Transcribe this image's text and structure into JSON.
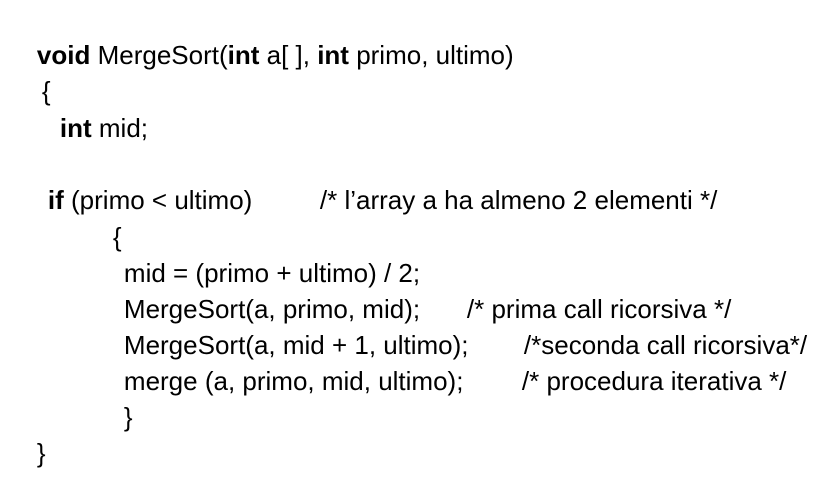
{
  "code": {
    "lines": [
      {
        "id": "signature",
        "parts": [
          {
            "text": "void",
            "bold": true
          },
          {
            "text": " MergeSort(",
            "bold": false
          },
          {
            "text": "int",
            "bold": true
          },
          {
            "text": " a[ ], ",
            "bold": false
          },
          {
            "text": "int",
            "bold": true
          },
          {
            "text": " primo, ultimo)",
            "bold": false
          }
        ]
      },
      {
        "id": "open-brace-func",
        "parts": [
          {
            "text": "{",
            "bold": false
          }
        ]
      },
      {
        "id": "decl-mid",
        "parts": [
          {
            "text": "int",
            "bold": true
          },
          {
            "text": " mid;",
            "bold": false
          }
        ]
      },
      {
        "id": "if-statement",
        "parts": [
          {
            "text": "if",
            "bold": true
          },
          {
            "text": " (primo < ultimo)",
            "bold": false
          }
        ],
        "comment": "/* l’array a ha almeno 2 elementi */"
      },
      {
        "id": "open-brace-if",
        "parts": [
          {
            "text": "{",
            "bold": false
          }
        ]
      },
      {
        "id": "assign-mid",
        "parts": [
          {
            "text": "mid = (primo + ultimo) / 2;",
            "bold": false
          }
        ]
      },
      {
        "id": "first-recursive-call",
        "parts": [
          {
            "text": "MergeSort(a, primo, mid);",
            "bold": false
          }
        ],
        "comment": "/* prima call ricorsiva */"
      },
      {
        "id": "second-recursive-call",
        "parts": [
          {
            "text": "MergeSort(a, mid + 1, ultimo);",
            "bold": false
          }
        ],
        "comment": "/*seconda call ricorsiva*/"
      },
      {
        "id": "merge-call",
        "parts": [
          {
            "text": "merge (a, primo, mid, ultimo);",
            "bold": false
          }
        ],
        "comment": "/* procedura iterativa */"
      },
      {
        "id": "close-brace-if",
        "parts": [
          {
            "text": "}",
            "bold": false
          }
        ]
      },
      {
        "id": "close-brace-func",
        "parts": [
          {
            "text": "}",
            "bold": false
          }
        ]
      }
    ]
  }
}
